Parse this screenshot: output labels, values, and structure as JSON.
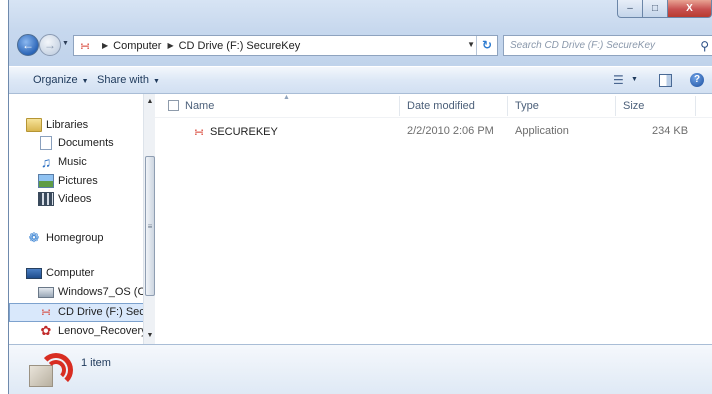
{
  "window": {
    "controls": {
      "minimize": "–",
      "maximize": "□",
      "close": "X"
    }
  },
  "nav": {
    "back_icon": "back-arrow-icon",
    "forward_icon": "forward-arrow-icon",
    "breadcrumbs": [
      "Computer",
      "CD Drive (F:) SecureKey"
    ],
    "search_placeholder": "Search CD Drive (F:) SecureKey"
  },
  "toolbar": {
    "organize_label": "Organize",
    "share_label": "Share with"
  },
  "sidebar": {
    "items": [
      {
        "label": "Libraries",
        "icon": "libraries-icon"
      },
      {
        "label": "Documents",
        "icon": "documents-icon"
      },
      {
        "label": "Music",
        "icon": "music-icon"
      },
      {
        "label": "Pictures",
        "icon": "pictures-icon"
      },
      {
        "label": "Videos",
        "icon": "videos-icon"
      },
      {
        "label": "Homegroup",
        "icon": "homegroup-icon"
      },
      {
        "label": "Computer",
        "icon": "computer-icon"
      },
      {
        "label": "Windows7_OS (C",
        "icon": "drive-icon"
      },
      {
        "label": "CD Drive (F:) Secu",
        "icon": "cd-drive-icon",
        "selected": true
      },
      {
        "label": "Lenovo_Recovery",
        "icon": "recovery-drive-icon"
      }
    ]
  },
  "file_list": {
    "columns": [
      "Name",
      "Date modified",
      "Type",
      "Size"
    ],
    "rows": [
      {
        "name": "SECUREKEY",
        "date_modified": "2/2/2010 2:06 PM",
        "type": "Application",
        "size": "234 KB"
      }
    ]
  },
  "details": {
    "item_count": "1 item"
  },
  "colors": {
    "accent": "#2d7bd0",
    "close_button": "#c75050",
    "cd_icon": "#d82d22",
    "selection": "#d9e8fb"
  }
}
